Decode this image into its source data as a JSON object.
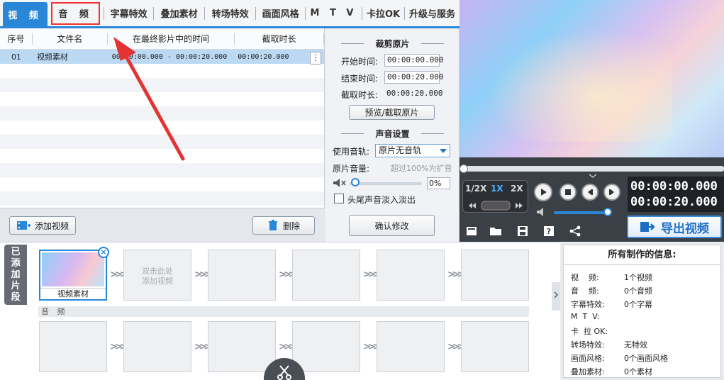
{
  "tabs": [
    {
      "label": "视 频"
    },
    {
      "label": "音 频"
    },
    {
      "label": "字幕特效"
    },
    {
      "label": "叠加素材"
    },
    {
      "label": "转场特效"
    },
    {
      "label": "画面风格"
    },
    {
      "label": "M T V"
    },
    {
      "label": "卡拉OK"
    },
    {
      "label": "升级与服务"
    }
  ],
  "file_list": {
    "headers": [
      "序号",
      "文件名",
      "在最终影片中的时间",
      "截取时长"
    ],
    "rows": [
      {
        "index": "01",
        "name": "视频素材",
        "range": "00:00:00.000 - 00:00:20.000",
        "duration": "00:00:20.000"
      }
    ],
    "more": "⋮"
  },
  "list_buttons": {
    "add_video": "添加视频",
    "delete": "删除"
  },
  "trim": {
    "title": "裁剪原片",
    "start_label": "开始时间:",
    "start_value": "00:00:00.000",
    "end_label": "结束时间:",
    "end_value": "00:00:20.000",
    "dur_label": "截取时长:",
    "dur_value": "00:00:20.000",
    "preview_button": "预览/截取原片"
  },
  "audio": {
    "title": "声音设置",
    "track_label": "使用音轨:",
    "track_value": "原片无音轨",
    "volume_label": "原片音量:",
    "volume_hint": "超过100%为扩音",
    "volume_value": "0%",
    "fade_label": "头尾声音淡入淡出",
    "confirm_button": "确认修改"
  },
  "player": {
    "speeds": [
      "1/2X",
      "1X",
      "2X"
    ],
    "active_speed": "1X",
    "time_current": "00:00:00.000",
    "time_total": "00:00:20.000",
    "progress": 0,
    "volume": 0.92,
    "export_label": "导出视频"
  },
  "timeline": {
    "side_tab": [
      "已",
      "添",
      "加",
      "片",
      "段"
    ],
    "first_clip": "视频素材",
    "hint_line1": "双击此处",
    "hint_line2": "添加视频",
    "audio_label": "音 频"
  },
  "info": {
    "title": "所有制作的信息:",
    "rows": [
      {
        "k": "视    频:",
        "v": "1个视频"
      },
      {
        "k": "音    频:",
        "v": "0个音频"
      },
      {
        "k": "字幕特效:",
        "v": "0个字幕"
      },
      {
        "k": "M  T  V:",
        "v": ""
      },
      {
        "k": "卡  拉 OK:",
        "v": ""
      },
      {
        "k": "转场特效:",
        "v": "无特效"
      },
      {
        "k": "画面风格:",
        "v": "0个画面风格"
      },
      {
        "k": "叠加素材:",
        "v": "0个素材"
      }
    ]
  },
  "colors": {
    "accent": "#2a87d8",
    "annotation": "#e33333"
  }
}
